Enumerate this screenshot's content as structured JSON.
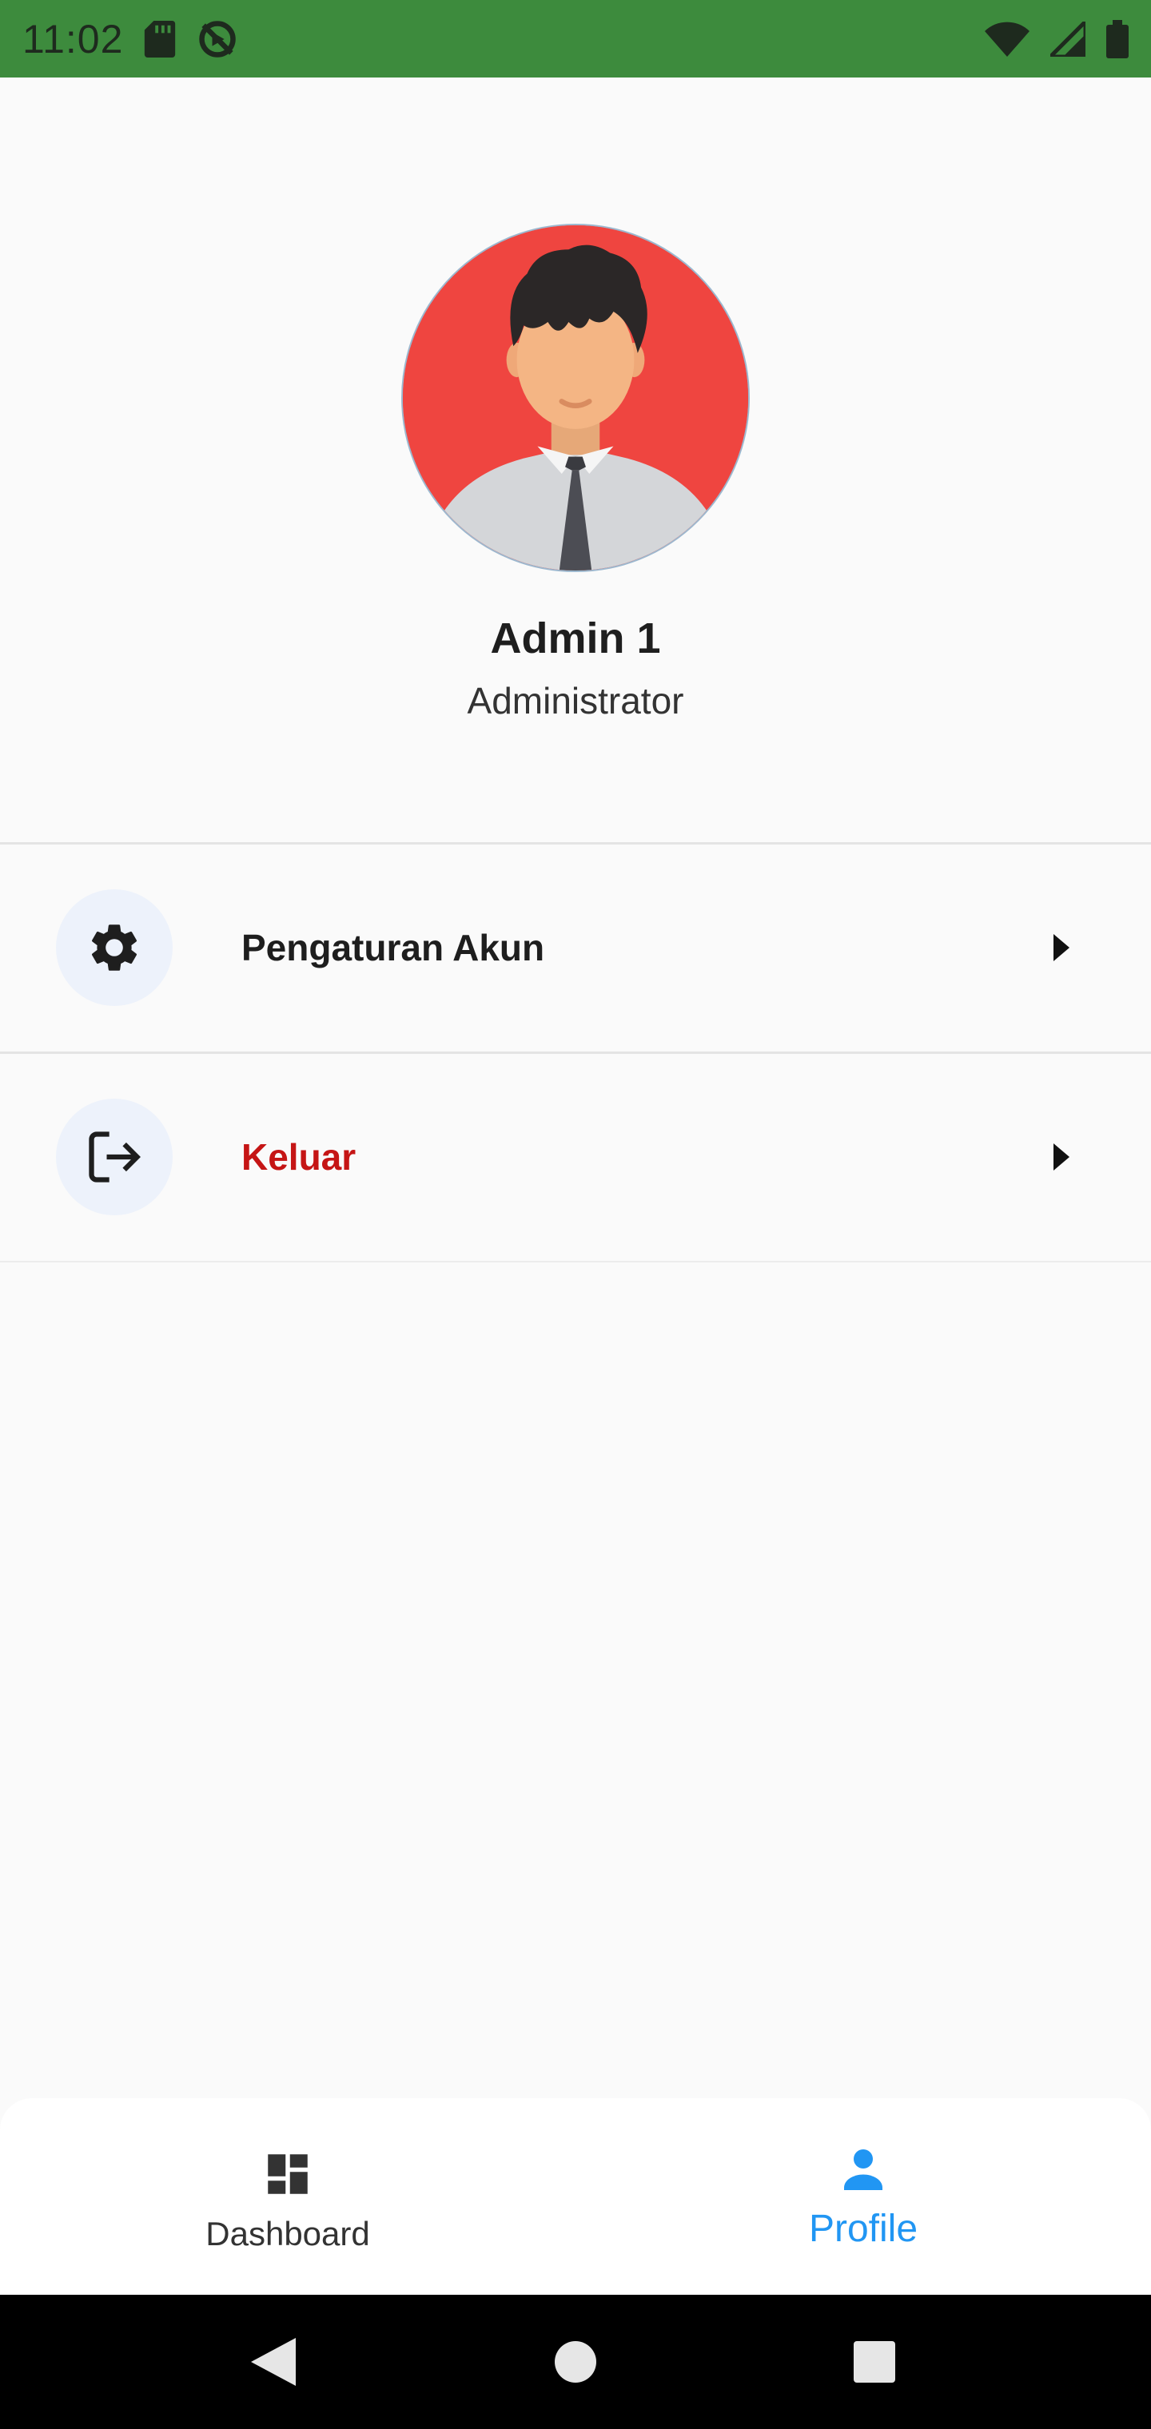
{
  "status_bar": {
    "time": "11:02",
    "left_icons": [
      "sd-card-icon",
      "sync-off-icon"
    ],
    "right_icons": [
      "wifi-icon",
      "cell-signal-icon",
      "battery-icon"
    ],
    "background": "#3d8b3d"
  },
  "profile": {
    "name": "Admin 1",
    "role": "Administrator",
    "avatar_icon": "avatar-man-with-tie",
    "avatar_bg": "#ef4540"
  },
  "menu": {
    "items": [
      {
        "label": "Pengaturan Akun",
        "icon": "gear-icon",
        "color": "#1e1e1e"
      },
      {
        "label": "Keluar",
        "icon": "logout-icon",
        "color": "#c51515"
      }
    ]
  },
  "bottom_nav": {
    "items": [
      {
        "label": "Dashboard",
        "icon": "dashboard-icon",
        "active": false
      },
      {
        "label": "Profile",
        "icon": "person-icon",
        "active": true
      }
    ],
    "active_color": "#2196f3",
    "inactive_color": "#333333"
  },
  "system_nav": {
    "buttons": [
      "back-icon",
      "home-icon",
      "recents-icon"
    ]
  }
}
